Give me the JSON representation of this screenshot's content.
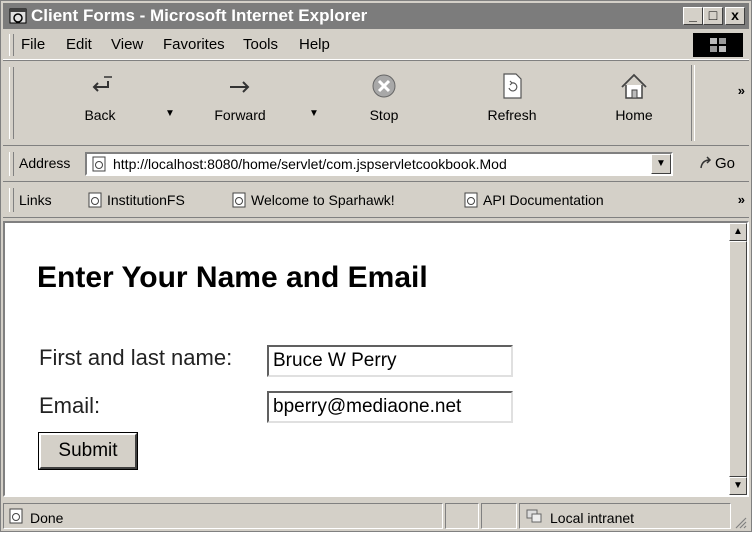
{
  "window": {
    "title": "Client Forms - Microsoft Internet Explorer",
    "controls": {
      "minimize": "_",
      "maximize": "□",
      "close": "x"
    }
  },
  "menu": [
    "File",
    "Edit",
    "View",
    "Favorites",
    "Tools",
    "Help"
  ],
  "toolbar": {
    "back": "Back",
    "forward": "Forward",
    "stop": "Stop",
    "refresh": "Refresh",
    "home": "Home",
    "more": "»"
  },
  "address": {
    "label": "Address",
    "url": "http://localhost:8080/home/servlet/com.jspservletcookbook.Mod",
    "go": "Go"
  },
  "links": {
    "label": "Links",
    "items": [
      "InstitutionFS",
      "Welcome to Sparhawk!",
      "API Documentation"
    ],
    "more": "»"
  },
  "page": {
    "heading": "Enter Your Name and Email",
    "name_label": "First and last name:",
    "name_value": "Bruce W Perry",
    "email_label": "Email:",
    "email_value": "bperry@mediaone.net",
    "submit": "Submit"
  },
  "status": {
    "text": "Done",
    "zone": "Local intranet"
  },
  "icons": {
    "app": "ie-icon",
    "back": "back-arrow-icon",
    "forward": "forward-arrow-icon",
    "stop": "stop-icon",
    "refresh": "refresh-icon",
    "home": "home-icon",
    "page": "page-icon",
    "go": "go-arrow-icon",
    "zone": "intranet-icon"
  }
}
